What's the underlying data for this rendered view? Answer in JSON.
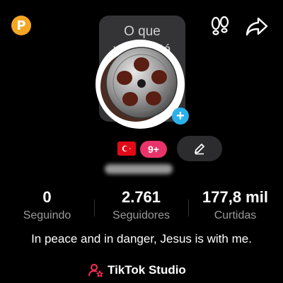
{
  "header": {
    "premium_badge_letter": "P",
    "icons": [
      "footprint-icon",
      "share-icon"
    ]
  },
  "note_bubble": {
    "line1": "O que",
    "line2": "você está"
  },
  "avatar": {
    "icon": "film-reel-icon"
  },
  "badges": {
    "flag": "turkey-flag-icon",
    "count": "9+",
    "edit_icon": "pencil-icon"
  },
  "stats": [
    {
      "value": "0",
      "label": "Seguindo"
    },
    {
      "value": "2.761",
      "label": "Seguidores"
    },
    {
      "value": "177,8 mil",
      "label": "Curtidas"
    }
  ],
  "bio": "In peace and in danger, Jesus is with me.",
  "studio": {
    "label": "TikTok Studio",
    "icon": "person-star-icon"
  },
  "colors": {
    "background": "#000000",
    "premium": "#f5a623",
    "count_badge": "#e8346a",
    "add_badge": "#2bb0ea",
    "studio_icon": "#fe2c55"
  }
}
